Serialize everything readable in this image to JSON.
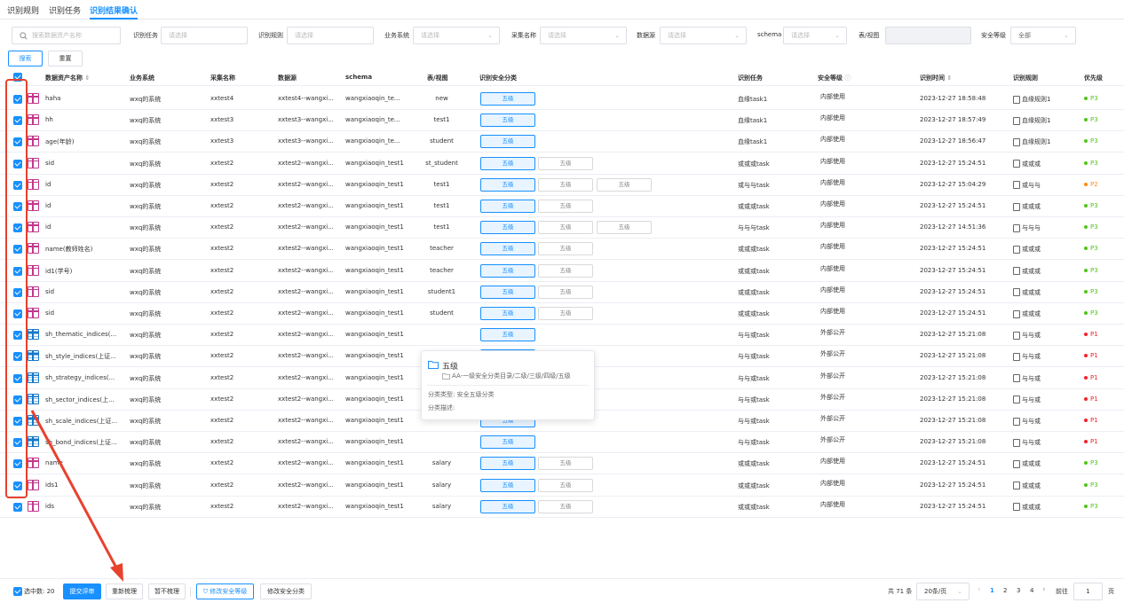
{
  "tabs": [
    "识别规则",
    "识别任务",
    "识别结果确认"
  ],
  "filters": {
    "search_placeholder": "搜索数据资产名称",
    "task_label": "识别任务",
    "task_placeholder": "请选择",
    "rule_label": "识别规则",
    "rule_placeholder": "请选择",
    "biz_label": "业务系统",
    "biz_placeholder": "请选择",
    "collect_label": "采集名称",
    "collect_placeholder": "请选择",
    "datasource_label": "数据源",
    "datasource_placeholder": "请选择",
    "schema_label": "schema",
    "schema_placeholder": "请选择",
    "tableview_label": "表/视图",
    "tableview_value": "",
    "level_label": "安全等级",
    "level_value": "全部",
    "search_btn": "搜索",
    "reset_btn": "重置"
  },
  "columns": {
    "name": "数据资产名称",
    "biz": "业务系统",
    "collect": "采集名称",
    "datasource": "数据源",
    "schema": "schema",
    "tableview": "表/视图",
    "classify": "识别安全分类",
    "task": "识别任务",
    "level": "安全等级",
    "time": "识别时间",
    "rule": "识别规则",
    "priority": "优先级"
  },
  "colors": {
    "accent": "#1890ff",
    "p1": "#f5222d",
    "p2": "#fa8c16",
    "p3": "#52c41a",
    "annotation": "#e8412d"
  },
  "rows": [
    {
      "icon": "pink",
      "name": "haha",
      "biz": "wxq的系统",
      "collect": "xxtest4",
      "ds": "xxtest4--wangxi...",
      "schema": "wangxiaoqin_te...",
      "tv": "new",
      "chips": [
        "五级"
      ],
      "task": "血缘task1",
      "level": "内部使用",
      "time": "2023-12-27 18:58:48",
      "rule_icon": "lineage-icon",
      "rule": "血缘规则1",
      "priority": "P3"
    },
    {
      "icon": "pink",
      "name": "hh",
      "biz": "wxq的系统",
      "collect": "xxtest3",
      "ds": "xxtest3--wangxi...",
      "schema": "wangxiaoqin_te...",
      "tv": "test1",
      "chips": [
        "五级"
      ],
      "task": "血缘task1",
      "level": "内部使用",
      "time": "2023-12-27 18:57:49",
      "rule_icon": "lineage-icon",
      "rule": "血缘规则1",
      "priority": "P3"
    },
    {
      "icon": "pink",
      "name": "age(年龄)",
      "biz": "wxq的系统",
      "collect": "xxtest3",
      "ds": "xxtest3--wangxi...",
      "schema": "wangxiaoqin_te...",
      "tv": "student",
      "chips": [
        "五级"
      ],
      "task": "血缘task1",
      "level": "内部使用",
      "time": "2023-12-27 18:56:47",
      "rule_icon": "lineage-icon",
      "rule": "血缘规则1",
      "priority": "P3"
    },
    {
      "icon": "pink",
      "name": "sid",
      "biz": "wxq的系统",
      "collect": "xxtest2",
      "ds": "xxtest2--wangxi...",
      "schema": "wangxiaoqin_test1",
      "tv": "st_student",
      "chips": [
        "五级",
        "五级"
      ],
      "task": "或或或task",
      "level": "内部使用",
      "time": "2023-12-27 15:24:51",
      "rule_icon": "doc-icon",
      "rule": "或或或",
      "priority": "P3"
    },
    {
      "icon": "pink",
      "name": "id",
      "biz": "wxq的系统",
      "collect": "xxtest2",
      "ds": "xxtest2--wangxi...",
      "schema": "wangxiaoqin_test1",
      "tv": "test1",
      "chips": [
        "五级",
        "五级",
        "五级"
      ],
      "task": "或与与task",
      "level": "内部使用",
      "time": "2023-12-27 15:04:29",
      "rule_icon": "doc-icon",
      "rule": "或与与",
      "priority": "P2"
    },
    {
      "icon": "pink",
      "name": "id",
      "biz": "wxq的系统",
      "collect": "xxtest2",
      "ds": "xxtest2--wangxi...",
      "schema": "wangxiaoqin_test1",
      "tv": "test1",
      "chips": [
        "五级",
        "五级"
      ],
      "task": "或或或task",
      "level": "内部使用",
      "time": "2023-12-27 15:24:51",
      "rule_icon": "doc-icon",
      "rule": "或或或",
      "priority": "P3"
    },
    {
      "icon": "pink",
      "name": "id",
      "biz": "wxq的系统",
      "collect": "xxtest2",
      "ds": "xxtest2--wangxi...",
      "schema": "wangxiaoqin_test1",
      "tv": "test1",
      "chips": [
        "五级",
        "五级",
        "五级"
      ],
      "task": "与与与task",
      "level": "内部使用",
      "time": "2023-12-27 14:51:36",
      "rule_icon": "doc-icon",
      "rule": "与与与",
      "priority": "P3"
    },
    {
      "icon": "pink",
      "name": "name(教师姓名)",
      "biz": "wxq的系统",
      "collect": "xxtest2",
      "ds": "xxtest2--wangxi...",
      "schema": "wangxiaoqin_test1",
      "tv": "teacher",
      "chips": [
        "五级",
        "五级"
      ],
      "task": "或或或task",
      "level": "内部使用",
      "time": "2023-12-27 15:24:51",
      "rule_icon": "doc-icon",
      "rule": "或或或",
      "priority": "P3"
    },
    {
      "icon": "pink",
      "name": "id1(学号)",
      "biz": "wxq的系统",
      "collect": "xxtest2",
      "ds": "xxtest2--wangxi...",
      "schema": "wangxiaoqin_test1",
      "tv": "teacher",
      "chips": [
        "五级",
        "五级"
      ],
      "task": "或或或task",
      "level": "内部使用",
      "time": "2023-12-27 15:24:51",
      "rule_icon": "doc-icon",
      "rule": "或或或",
      "priority": "P3"
    },
    {
      "icon": "pink",
      "name": "sid",
      "biz": "wxq的系统",
      "collect": "xxtest2",
      "ds": "xxtest2--wangxi...",
      "schema": "wangxiaoqin_test1",
      "tv": "student1",
      "chips": [
        "五级",
        "五级"
      ],
      "task": "或或或task",
      "level": "内部使用",
      "time": "2023-12-27 15:24:51",
      "rule_icon": "doc-icon",
      "rule": "或或或",
      "priority": "P3"
    },
    {
      "icon": "pink",
      "name": "sid",
      "biz": "wxq的系统",
      "collect": "xxtest2",
      "ds": "xxtest2--wangxi...",
      "schema": "wangxiaoqin_test1",
      "tv": "student",
      "chips": [
        "五级",
        "五级"
      ],
      "task": "或或或task",
      "level": "内部使用",
      "time": "2023-12-27 15:24:51",
      "rule_icon": "doc-icon",
      "rule": "或或或",
      "priority": "P3"
    },
    {
      "icon": "blue",
      "name": "sh_thematic_indices(...",
      "biz": "wxq的系统",
      "collect": "xxtest2",
      "ds": "xxtest2--wangxi...",
      "schema": "wangxiaoqin_test1",
      "tv": "",
      "chips": [
        "五级"
      ],
      "task": "与与或task",
      "level": "外部公开",
      "time": "2023-12-27 15:21:08",
      "rule_icon": "doc-icon",
      "rule": "与与或",
      "priority": "P1"
    },
    {
      "icon": "blue",
      "name": "sh_style_indices(上证...",
      "biz": "wxq的系统",
      "collect": "xxtest2",
      "ds": "xxtest2--wangxi...",
      "schema": "wangxiaoqin_test1",
      "tv": "",
      "chips": [
        "五级"
      ],
      "task": "与与或task",
      "level": "外部公开",
      "time": "2023-12-27 15:21:08",
      "rule_icon": "doc-icon",
      "rule": "与与或",
      "priority": "P1"
    },
    {
      "icon": "blue",
      "name": "sh_strategy_indices(...",
      "biz": "wxq的系统",
      "collect": "xxtest2",
      "ds": "xxtest2--wangxi...",
      "schema": "wangxiaoqin_test1",
      "tv": "",
      "chips": [
        "五级"
      ],
      "task": "与与或task",
      "level": "外部公开",
      "time": "2023-12-27 15:21:08",
      "rule_icon": "doc-icon",
      "rule": "与与或",
      "priority": "P1"
    },
    {
      "icon": "blue",
      "name": "sh_sector_indices(上...",
      "biz": "wxq的系统",
      "collect": "xxtest2",
      "ds": "xxtest2--wangxi...",
      "schema": "wangxiaoqin_test1",
      "tv": "",
      "chips": [
        "五级"
      ],
      "task": "与与或task",
      "level": "外部公开",
      "time": "2023-12-27 15:21:08",
      "rule_icon": "doc-icon",
      "rule": "与与或",
      "priority": "P1"
    },
    {
      "icon": "blue",
      "name": "sh_scale_indices(上证...",
      "biz": "wxq的系统",
      "collect": "xxtest2",
      "ds": "xxtest2--wangxi...",
      "schema": "wangxiaoqin_test1",
      "tv": "",
      "chips": [
        "五级"
      ],
      "task": "与与或task",
      "level": "外部公开",
      "time": "2023-12-27 15:21:08",
      "rule_icon": "doc-icon",
      "rule": "与与或",
      "priority": "P1"
    },
    {
      "icon": "blue",
      "name": "sh_bond_indices(上证...",
      "biz": "wxq的系统",
      "collect": "xxtest2",
      "ds": "xxtest2--wangxi...",
      "schema": "wangxiaoqin_test1",
      "tv": "",
      "chips": [
        "五级"
      ],
      "task": "与与或task",
      "level": "外部公开",
      "time": "2023-12-27 15:21:08",
      "rule_icon": "doc-icon",
      "rule": "与与或",
      "priority": "P1"
    },
    {
      "icon": "pink",
      "name": "name",
      "biz": "wxq的系统",
      "collect": "xxtest2",
      "ds": "xxtest2--wangxi...",
      "schema": "wangxiaoqin_test1",
      "tv": "salary",
      "chips": [
        "五级",
        "五级"
      ],
      "task": "或或或task",
      "level": "内部使用",
      "time": "2023-12-27 15:24:51",
      "rule_icon": "doc-icon",
      "rule": "或或或",
      "priority": "P3"
    },
    {
      "icon": "pink",
      "name": "ids1",
      "biz": "wxq的系统",
      "collect": "xxtest2",
      "ds": "xxtest2--wangxi...",
      "schema": "wangxiaoqin_test1",
      "tv": "salary",
      "chips": [
        "五级",
        "五级"
      ],
      "task": "或或或task",
      "level": "内部使用",
      "time": "2023-12-27 15:24:51",
      "rule_icon": "doc-icon",
      "rule": "或或或",
      "priority": "P3"
    },
    {
      "icon": "pink",
      "name": "ids",
      "biz": "wxq的系统",
      "collect": "xxtest2",
      "ds": "xxtest2--wangxi...",
      "schema": "wangxiaoqin_test1",
      "tv": "salary",
      "chips": [
        "五级",
        "五级"
      ],
      "task": "或或或task",
      "level": "内部使用",
      "time": "2023-12-27 15:24:51",
      "rule_icon": "doc-icon",
      "rule": "或或或",
      "priority": "P3"
    }
  ],
  "tooltip": {
    "title": "五级",
    "path": "AA-一级安全分类目录/二级/三级/四级/五级",
    "type_label": "分类类型:",
    "type_value": "安全五级分类",
    "desc_label": "分类描述:"
  },
  "footer": {
    "selected_label": "选中数: 20",
    "submit_btn": "提交评审",
    "reorganize_btn": "重新梳理",
    "skip_btn": "暂不梳理",
    "modify_level_btn": "修改安全等级",
    "modify_class_btn": "修改安全分类",
    "total": "共 71 条",
    "page_size": "20条/页",
    "prev": "‹",
    "pages": [
      "1",
      "2",
      "3",
      "4"
    ],
    "next": "›",
    "goto_label": "前往",
    "goto_value": "1",
    "page_unit": "页"
  }
}
